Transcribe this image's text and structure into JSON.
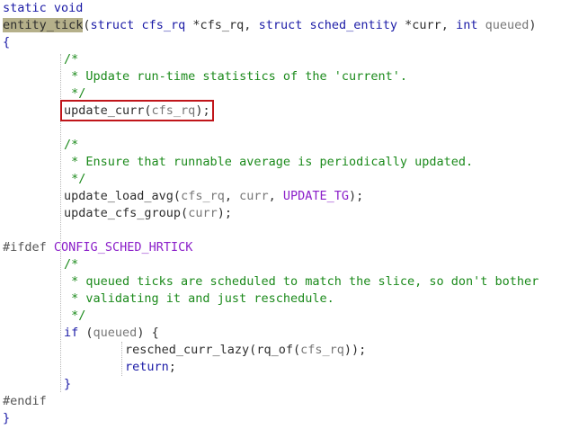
{
  "code": {
    "l1": {
      "kw1": "static",
      "kw2": "void"
    },
    "l2": {
      "name": "entity_tick",
      "p1": "(",
      "struct1": "struct",
      "type1": "cfs_rq",
      "arg1": "*cfs_rq,",
      "struct2": "struct",
      "type2": "sched_entity",
      "arg2": "*curr,",
      "kw_int": "int",
      "arg3": "queued",
      "p2": ")"
    },
    "l3": {
      "brace": "{"
    },
    "l4": {
      "text": "/*"
    },
    "l5": {
      "text": " * Update run-time statistics of the 'current'."
    },
    "l6": {
      "text": " */"
    },
    "l7": {
      "fn": "update_curr",
      "open": "(",
      "arg": "cfs_rq",
      "close": ");"
    },
    "l9": {
      "text": "/*"
    },
    "l10": {
      "text": " * Ensure that runnable average is periodically updated."
    },
    "l11": {
      "text": " */"
    },
    "l12": {
      "fn": "update_load_avg",
      "open": "(",
      "arg1": "cfs_rq",
      "sep1": ", ",
      "arg2": "curr",
      "sep2": ", ",
      "const": "UPDATE_TG",
      "close": ");"
    },
    "l13": {
      "fn": "update_cfs_group",
      "open": "(",
      "arg": "curr",
      "close": ");"
    },
    "l15": {
      "pp": "#ifdef",
      "macro": "CONFIG_SCHED_HRTICK"
    },
    "l16": {
      "text": "/*"
    },
    "l17": {
      "text": " * queued ticks are scheduled to match the slice, so don't bother"
    },
    "l18": {
      "text": " * validating it and just reschedule."
    },
    "l19": {
      "text": " */"
    },
    "l20": {
      "kw": "if",
      "open": " (",
      "arg": "queued",
      "close": ") {"
    },
    "l21": {
      "fn": "resched_curr_lazy",
      "open1": "(",
      "fn2": "rq_of",
      "open2": "(",
      "arg": "cfs_rq",
      "close": "));"
    },
    "l22": {
      "kw": "return",
      "semi": ";"
    },
    "l23": {
      "brace": "}"
    },
    "l24": {
      "pp": "#endif"
    },
    "l25": {
      "brace": "}"
    }
  }
}
